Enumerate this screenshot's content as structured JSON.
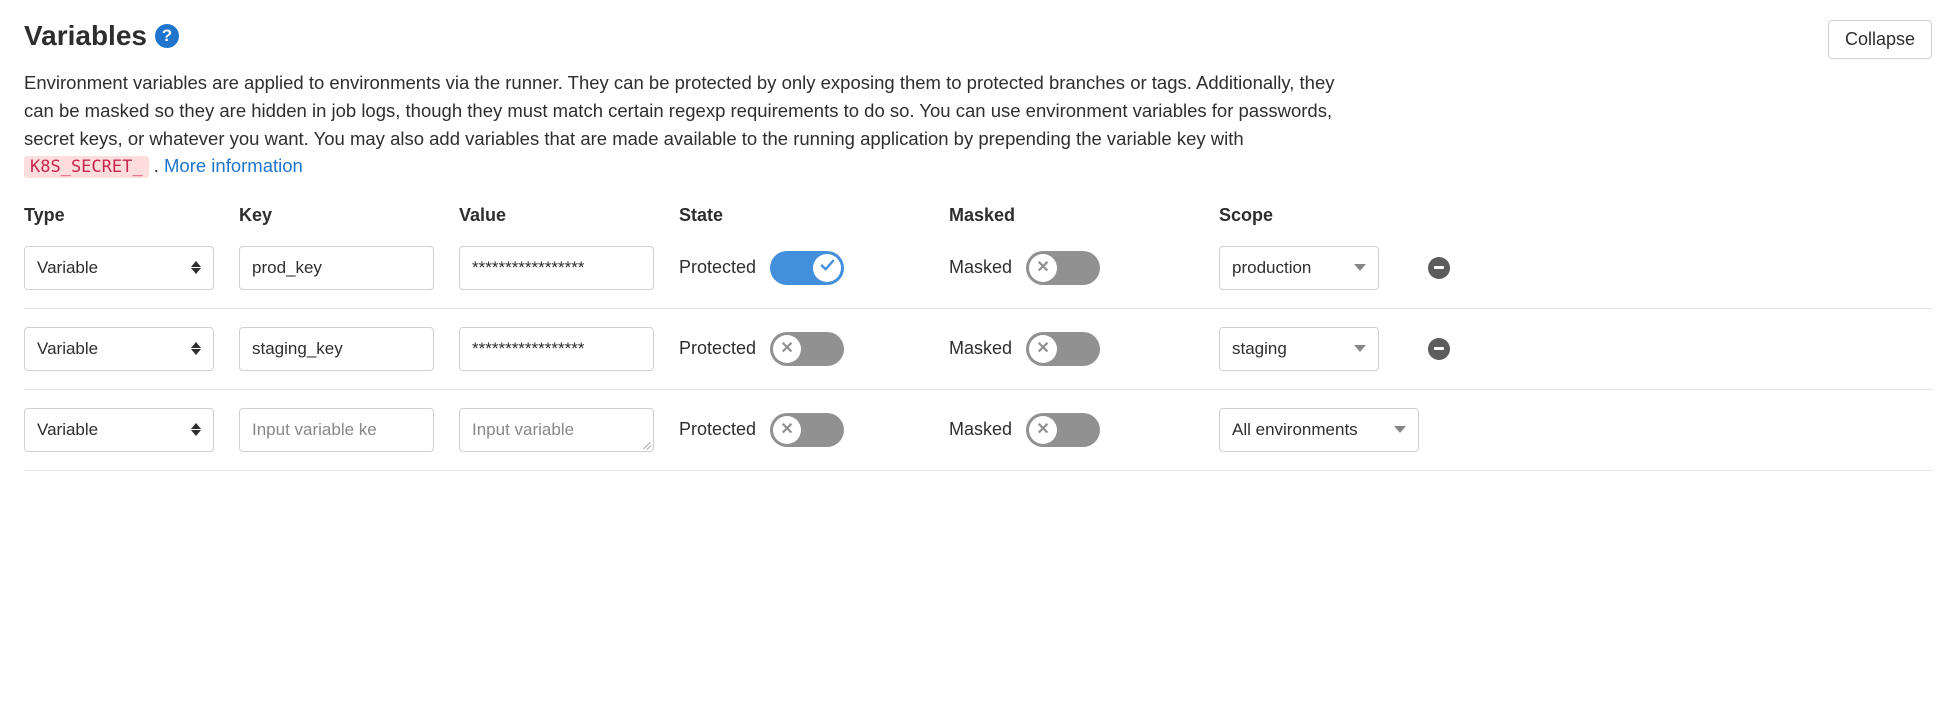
{
  "header": {
    "title": "Variables",
    "collapse_label": "Collapse"
  },
  "description": {
    "text_before_code": "Environment variables are applied to environments via the runner. They can be protected by only exposing them to protected branches or tags. Additionally, they can be masked so they are hidden in job logs, though they must match certain regexp requirements to do so. You can use environment variables for passwords, secret keys, or whatever you want. You may also add variables that are made available to the running application by prepending the variable key with ",
    "code": "K8S_SECRET_",
    "text_after_code": ". ",
    "link_text": "More information"
  },
  "columns": {
    "type": "Type",
    "key": "Key",
    "value": "Value",
    "state": "State",
    "masked": "Masked",
    "scope": "Scope"
  },
  "labels": {
    "protected": "Protected",
    "masked": "Masked"
  },
  "placeholders": {
    "key": "Input variable ke",
    "value": "Input variable"
  },
  "rows": [
    {
      "type": "Variable",
      "key": "prod_key",
      "value": "*****************",
      "protected": true,
      "masked": false,
      "scope": "production",
      "scope_width": "narrow",
      "removable": true
    },
    {
      "type": "Variable",
      "key": "staging_key",
      "value": "*****************",
      "protected": false,
      "masked": false,
      "scope": "staging",
      "scope_width": "narrow",
      "removable": true
    },
    {
      "type": "Variable",
      "key": "",
      "value": "",
      "protected": false,
      "masked": false,
      "scope": "All environments",
      "scope_width": "wide",
      "removable": false,
      "resizable_value": true
    }
  ]
}
